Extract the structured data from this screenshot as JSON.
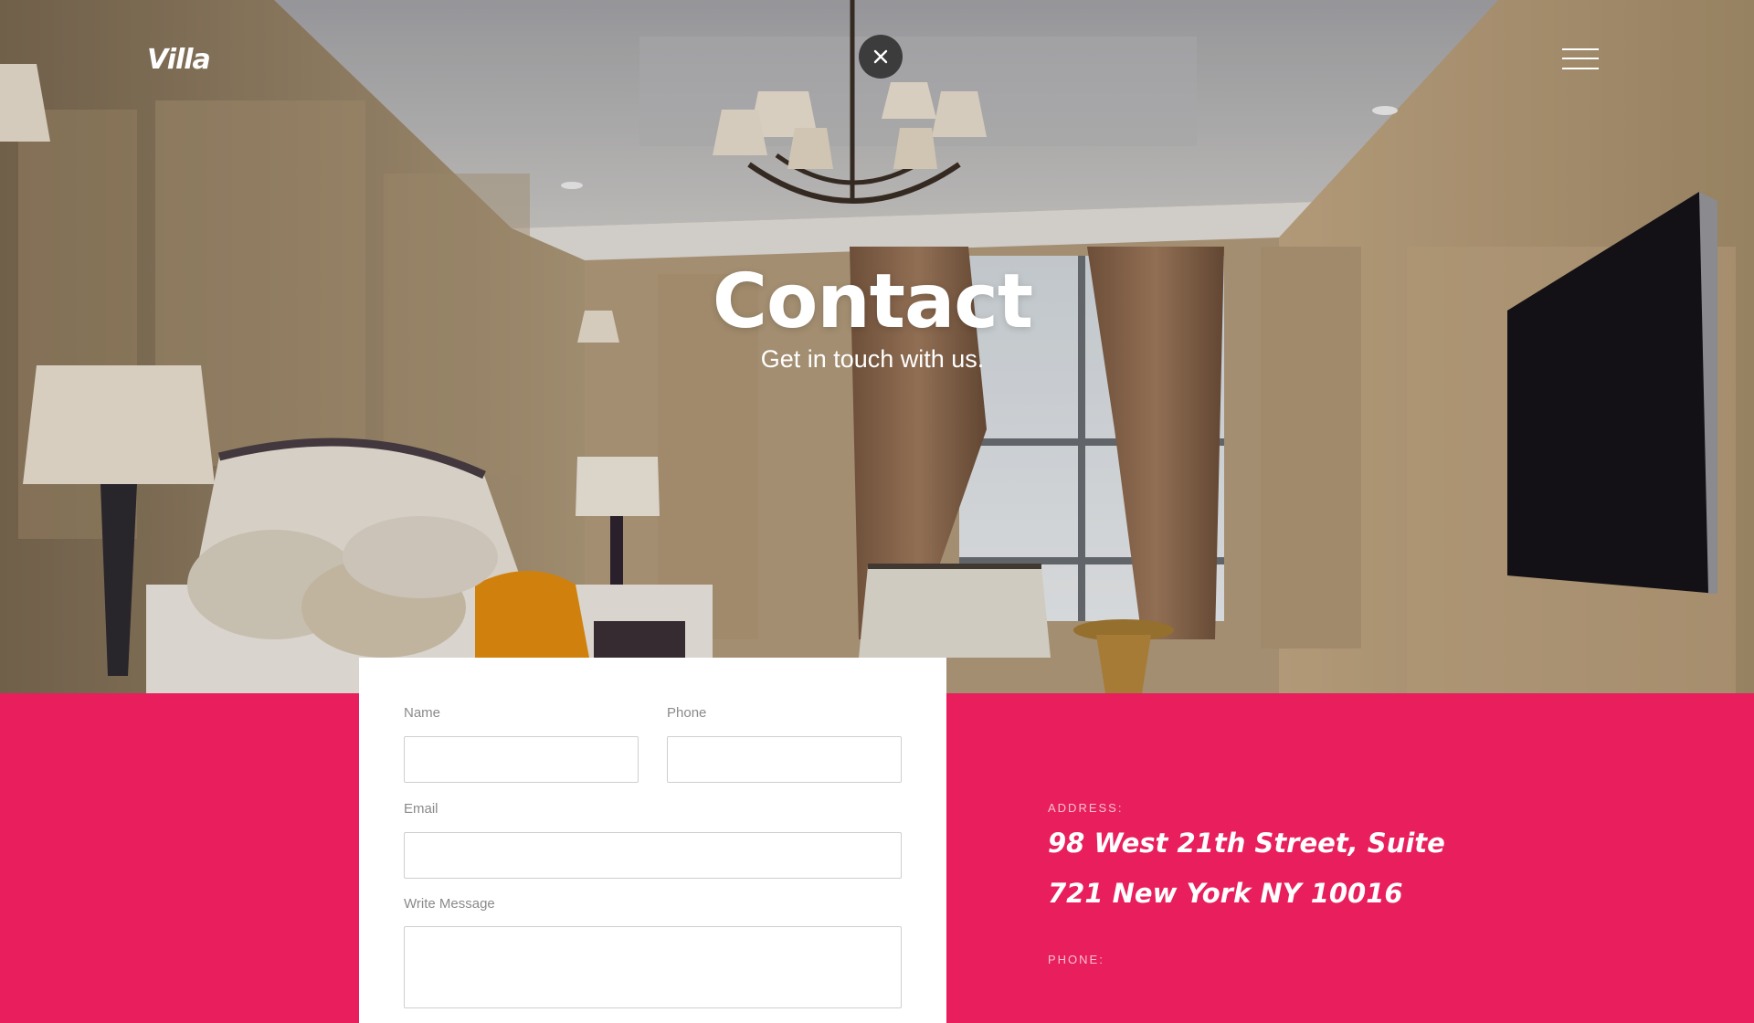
{
  "brand": {
    "logo_text": "Villa"
  },
  "header": {
    "close_icon": "close-icon",
    "menu_icon": "hamburger-menu-icon"
  },
  "hero": {
    "title": "Contact",
    "subtitle": "Get in touch with us."
  },
  "form": {
    "name_label": "Name",
    "name_value": "",
    "phone_label": "Phone",
    "phone_value": "",
    "email_label": "Email",
    "email_value": "",
    "message_label": "Write Message",
    "message_value": ""
  },
  "contact_info": {
    "address_label": "ADDRESS:",
    "address_line1": "98 West 21th Street, Suite",
    "address_line2": "721 New York NY 10016",
    "phone_label": "PHONE:"
  },
  "colors": {
    "accent": "#e91e5c",
    "close_button": "#3c3c3c",
    "card": "#ffffff"
  }
}
